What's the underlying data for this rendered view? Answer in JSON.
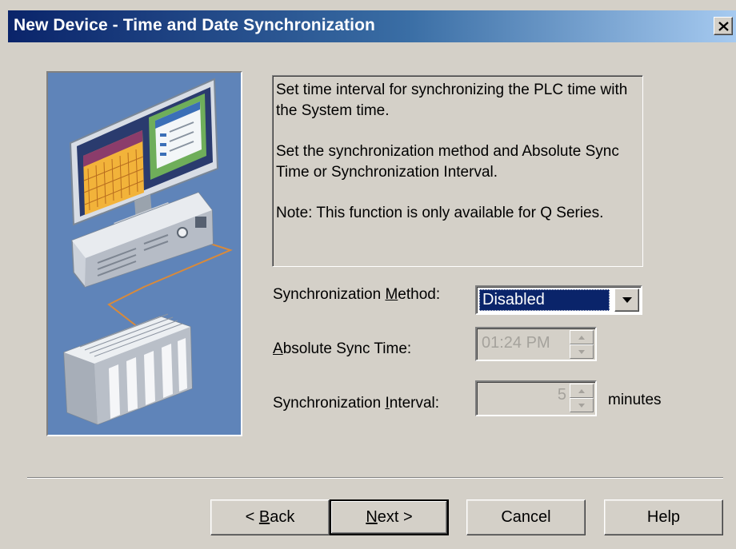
{
  "window": {
    "title": "New Device - Time and Date Synchronization",
    "close_symbol": "×"
  },
  "description": {
    "line1": "Set time interval for synchronizing the PLC time with the System time.",
    "line2": "Set the synchronization method and Absolute Sync Time or Synchronization Interval.",
    "line3": "Note: This function is only available for Q Series."
  },
  "form": {
    "sync_method": {
      "label_before": "Synchronization ",
      "label_accel": "M",
      "label_after": "ethod:",
      "value": "Disabled"
    },
    "absolute_time": {
      "label_accel": "A",
      "label_after": "bsolute Sync Time:",
      "value": "01:24 PM",
      "enabled": false
    },
    "interval": {
      "label_before": "Synchronization ",
      "label_accel": "I",
      "label_after": "nterval:",
      "value": "5",
      "unit": "minutes",
      "enabled": false
    }
  },
  "buttons": {
    "back_prefix": "< ",
    "back_accel": "B",
    "back_rest": "ack",
    "next_accel": "N",
    "next_rest": "ext >",
    "cancel": "Cancel",
    "help": "Help"
  },
  "icons": {
    "close": "close-icon",
    "dropdown": "dropdown-arrow-icon",
    "spin_up": "spin-up-icon",
    "spin_down": "spin-down-icon",
    "illustration": "computer-plc-illustration"
  },
  "colors": {
    "title_start": "#0a246a",
    "title_end": "#a6caf0",
    "dialog_bg": "#d4d0c8",
    "selection": "#0a246a",
    "illustration_bg": "#5f84b9"
  }
}
